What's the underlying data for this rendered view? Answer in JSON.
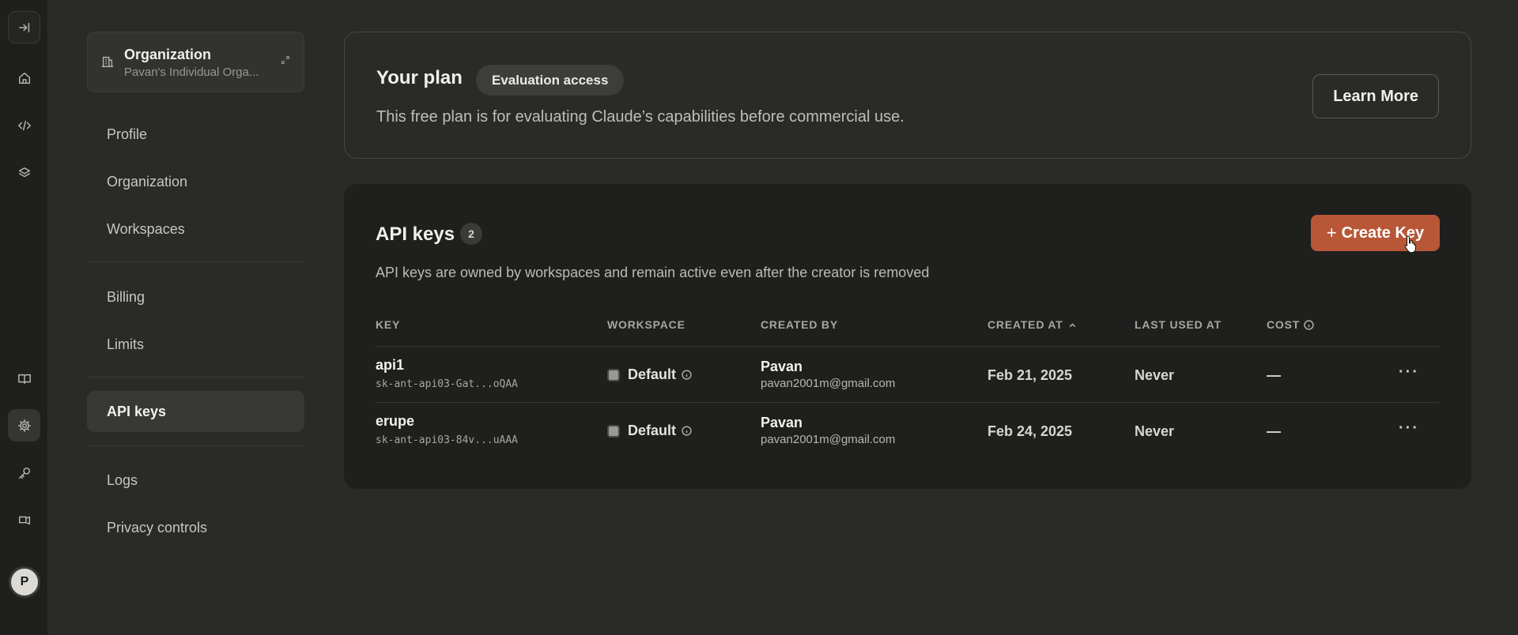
{
  "rail": {
    "avatar_letter": "P"
  },
  "org": {
    "title": "Organization",
    "subtitle": "Pavan's Individual Orga..."
  },
  "nav": {
    "profile": "Profile",
    "organization": "Organization",
    "workspaces": "Workspaces",
    "billing": "Billing",
    "limits": "Limits",
    "api_keys": "API keys",
    "logs": "Logs",
    "privacy": "Privacy controls"
  },
  "plan": {
    "title": "Your plan",
    "badge": "Evaluation access",
    "description": "This free plan is for evaluating Claude’s capabilities before commercial use.",
    "learn_more": "Learn More"
  },
  "keys": {
    "title": "API keys",
    "count": "2",
    "create_label": "Create Key",
    "create_plus": "+",
    "description": "API keys are owned by workspaces and remain active even after the creator is removed",
    "accent_color": "#b85738",
    "columns": {
      "key": "KEY",
      "workspace": "WORKSPACE",
      "created_by": "CREATED BY",
      "created_at": "CREATED AT",
      "last_used": "LAST USED AT",
      "cost": "COST"
    },
    "rows": [
      {
        "name": "api1",
        "key": "sk-ant-api03-Gat...oQAA",
        "workspace": "Default",
        "creator": "Pavan",
        "email": "pavan2001m@gmail.com",
        "created_at": "Feb 21, 2025",
        "last_used": "Never",
        "cost": "—",
        "menu": "···"
      },
      {
        "name": "erupe",
        "key": "sk-ant-api03-84v...uAAA",
        "workspace": "Default",
        "creator": "Pavan",
        "email": "pavan2001m@gmail.com",
        "created_at": "Feb 24, 2025",
        "last_used": "Never",
        "cost": "—",
        "menu": "···"
      }
    ]
  }
}
